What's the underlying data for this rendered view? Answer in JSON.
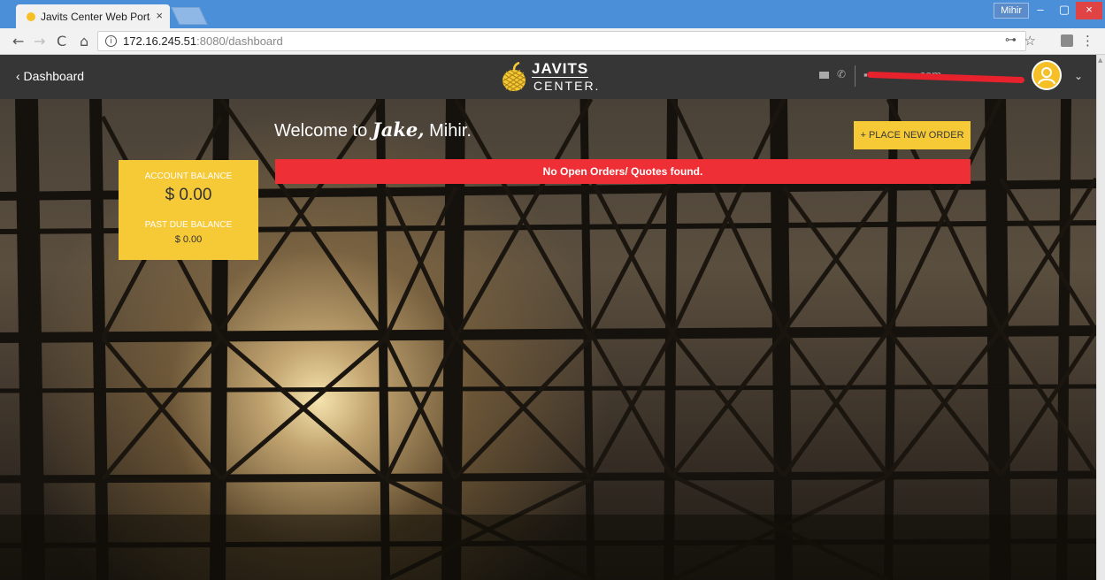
{
  "browser": {
    "tab_title": "Javits Center Web Portal",
    "tab_close": "×",
    "profile_name": "Mihir",
    "url_host": "172.16.245.51",
    "url_path": ":8080/dashboard",
    "window_min": "–",
    "window_max": "▢",
    "window_close": "×"
  },
  "header": {
    "back_label": "‹  Dashboard",
    "logo_word": "JAVITS",
    "logo_sub": "CENTER.",
    "email": "▪▪▪▪▪▪▪▪▪▪▪▪▪.com"
  },
  "dashboard": {
    "welcome_prefix": "Welcome to ",
    "welcome_brand": "Jake,",
    "welcome_name": " Mihir.",
    "place_order_label": "+ PLACE NEW ORDER",
    "alert_text": "No Open Orders/ Quotes found.",
    "account_balance_label": "ACCOUNT BALANCE",
    "account_balance_value": "$ 0.00",
    "past_due_label": "PAST DUE BALANCE",
    "past_due_value": "$ 0.00"
  },
  "colors": {
    "accent_yellow": "#f6c937",
    "alert_red": "#ee2f35",
    "header_bg": "#363636"
  }
}
